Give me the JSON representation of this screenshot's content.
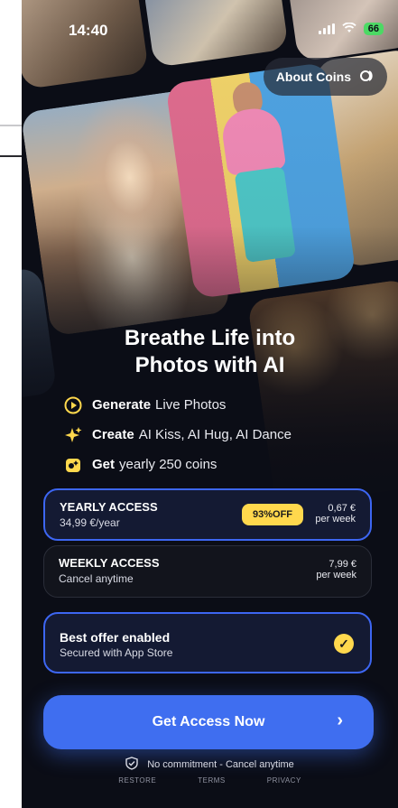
{
  "status_bar": {
    "time": "14:40",
    "battery": "66"
  },
  "header": {
    "about_coins_label": "About Coins"
  },
  "hero": {
    "headline_line1": "Breathe Life into",
    "headline_line2": "Photos with AI"
  },
  "features": [
    {
      "bold": "Generate",
      "rest": "Live Photos",
      "icon": "play-circle-icon"
    },
    {
      "bold": "Create",
      "rest": "AI Kiss, AI Hug, AI Dance",
      "icon": "sparkles-icon"
    },
    {
      "bold": "Get",
      "rest": "yearly 250 coins",
      "icon": "coins-icon"
    }
  ],
  "plans": {
    "yearly": {
      "title": "YEARLY ACCESS",
      "subtitle": "34,99 €/year",
      "badge": "93%OFF",
      "price": "0,67 €",
      "unit": "per week"
    },
    "weekly": {
      "title": "WEEKLY ACCESS",
      "subtitle": "Cancel anytime",
      "price": "7,99 €",
      "unit": "per week"
    }
  },
  "best_offer": {
    "title": "Best offer enabled",
    "subtitle": "Secured with App Store"
  },
  "cta": {
    "label": "Get Access Now"
  },
  "footer": {
    "commitment": "No commitment - Cancel anytime",
    "restore": "RESTORE",
    "terms": "TERMS",
    "privacy": "PRIVACY"
  },
  "colors": {
    "accent": "#3f6ef0",
    "badge": "#ffd84d",
    "background": "#0b0d16"
  }
}
